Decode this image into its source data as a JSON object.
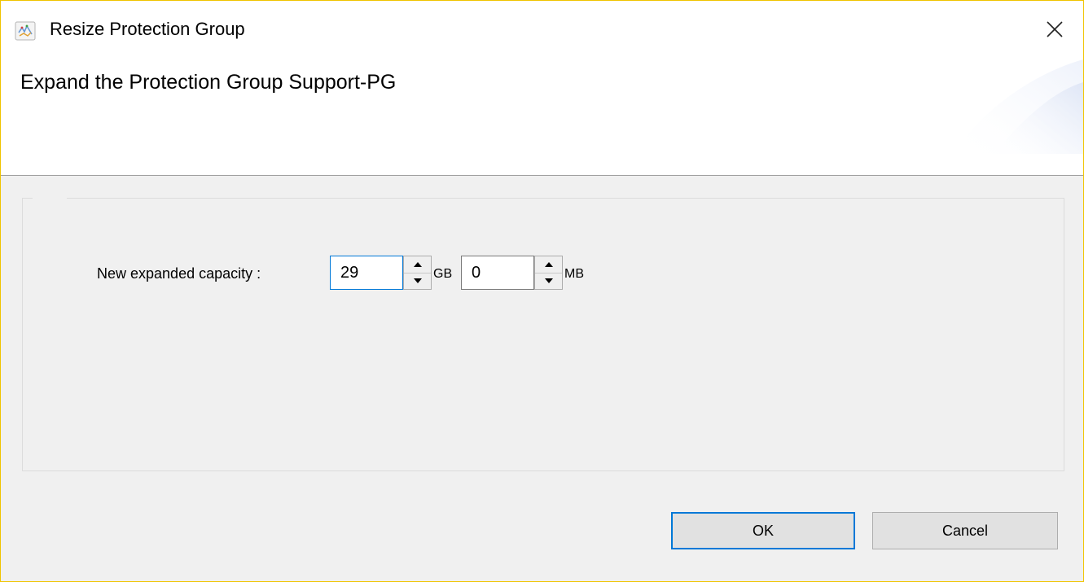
{
  "window": {
    "title": "Resize Protection Group",
    "icon": "app-icon",
    "close_icon": "close-icon"
  },
  "header": {
    "title": "Expand the Protection Group Support-PG"
  },
  "form": {
    "capacity_label": "New expanded capacity :",
    "gb_value": "29",
    "gb_unit": "GB",
    "mb_value": "0",
    "mb_unit": "MB"
  },
  "buttons": {
    "ok_label": "OK",
    "cancel_label": "Cancel"
  },
  "colors": {
    "window_border": "#f0c400",
    "focus_accent": "#0078d7",
    "body_background": "#f0f0f0"
  }
}
